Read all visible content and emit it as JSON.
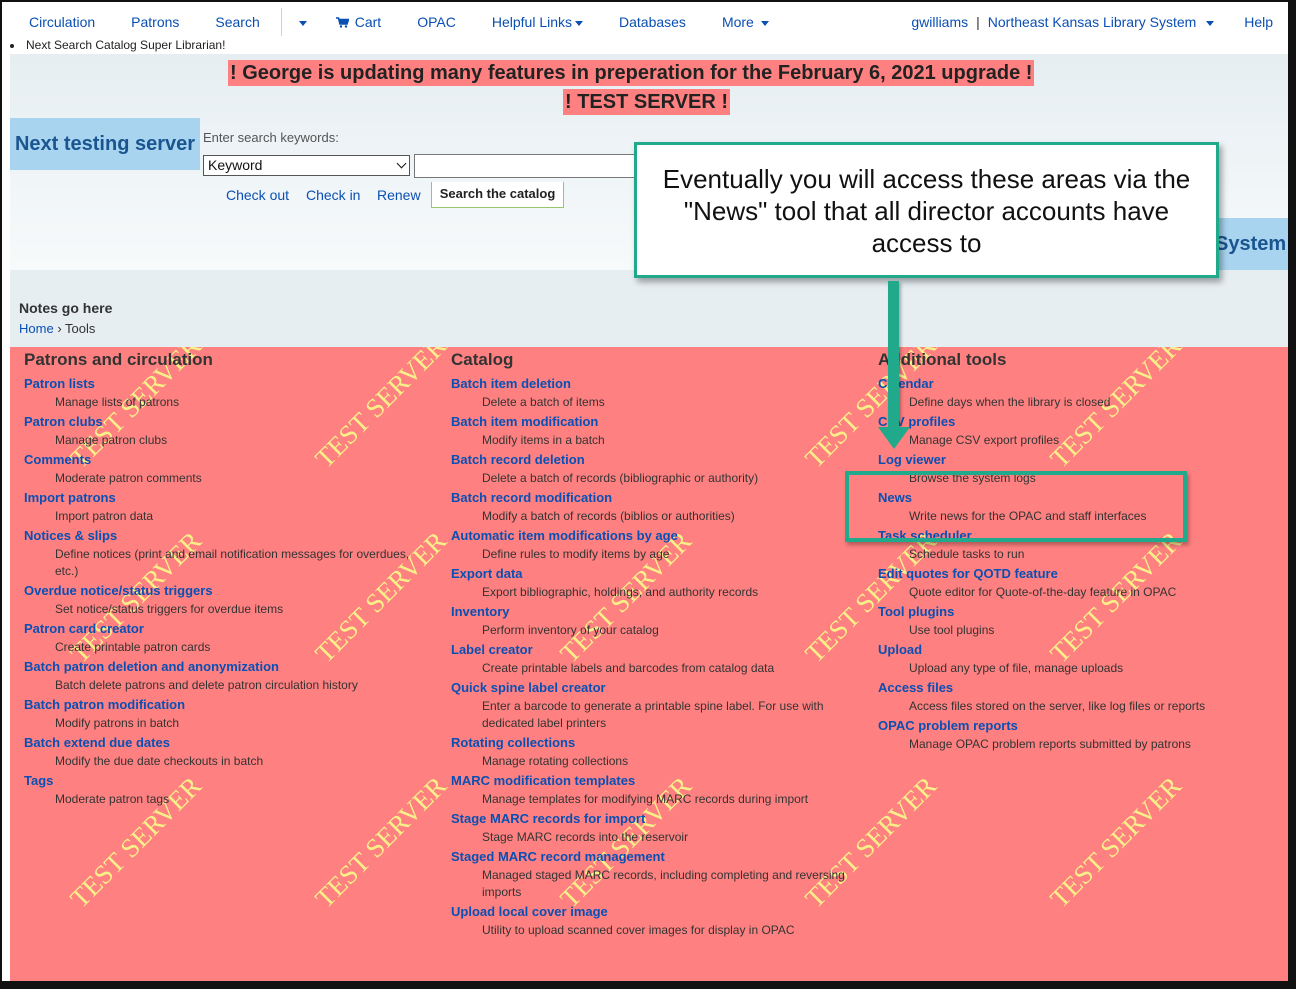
{
  "nav": {
    "items": [
      "Circulation",
      "Patrons",
      "Search"
    ],
    "cart": "Cart",
    "opac": "OPAC",
    "helpful_links": "Helpful Links",
    "databases": "Databases",
    "more": "More",
    "user": "gwilliams",
    "library": "Northeast Kansas Library System",
    "help": "Help"
  },
  "subline": "Next Search Catalog Super Librarian!",
  "alerts": {
    "line1": "! George is updating many features in preperation for the February 6, 2021 upgrade !",
    "line2": "! TEST SERVER !"
  },
  "header": {
    "server_label": "Next testing server",
    "server_label_right": "System"
  },
  "search": {
    "label": "Enter search keywords:",
    "select_value": "Keyword",
    "links": [
      "Check out",
      "Check in",
      "Renew"
    ],
    "tab": "Search the catalog"
  },
  "callout": "Eventually you will access these areas via the \"News\" tool that all director accounts have access to",
  "notes": "Notes go here",
  "breadcrumb": {
    "home": "Home",
    "sep": "›",
    "current": "Tools"
  },
  "columns": [
    {
      "heading": "Patrons and circulation",
      "tools": [
        {
          "title": "Patron lists",
          "desc": "Manage lists of patrons"
        },
        {
          "title": "Patron clubs",
          "desc": "Manage patron clubs"
        },
        {
          "title": "Comments",
          "desc": "Moderate patron comments"
        },
        {
          "title": "Import patrons",
          "desc": "Import patron data"
        },
        {
          "title": "Notices & slips",
          "desc": "Define notices (print and email notification messages for overdues, etc.)"
        },
        {
          "title": "Overdue notice/status triggers",
          "desc": "Set notice/status triggers for overdue items"
        },
        {
          "title": "Patron card creator",
          "desc": "Create printable patron cards"
        },
        {
          "title": "Batch patron deletion and anonymization",
          "desc": "Batch delete patrons and delete patron circulation history"
        },
        {
          "title": "Batch patron modification",
          "desc": "Modify patrons in batch"
        },
        {
          "title": "Batch extend due dates",
          "desc": "Modify the due date checkouts in batch"
        },
        {
          "title": "Tags",
          "desc": "Moderate patron tags"
        }
      ]
    },
    {
      "heading": "Catalog",
      "tools": [
        {
          "title": "Batch item deletion",
          "desc": "Delete a batch of items"
        },
        {
          "title": "Batch item modification",
          "desc": "Modify items in a batch"
        },
        {
          "title": "Batch record deletion",
          "desc": "Delete a batch of records (bibliographic or authority)"
        },
        {
          "title": "Batch record modification",
          "desc": "Modify a batch of records (biblios or authorities)"
        },
        {
          "title": "Automatic item modifications by age",
          "desc": "Define rules to modify items by age"
        },
        {
          "title": "Export data",
          "desc": "Export bibliographic, holdings, and authority records"
        },
        {
          "title": "Inventory",
          "desc": "Perform inventory of your catalog"
        },
        {
          "title": "Label creator",
          "desc": "Create printable labels and barcodes from catalog data"
        },
        {
          "title": "Quick spine label creator",
          "desc": "Enter a barcode to generate a printable spine label. For use with dedicated label printers"
        },
        {
          "title": "Rotating collections",
          "desc": "Manage rotating collections"
        },
        {
          "title": "MARC modification templates",
          "desc": "Manage templates for modifying MARC records during import"
        },
        {
          "title": "Stage MARC records for import",
          "desc": "Stage MARC records into the reservoir"
        },
        {
          "title": "Staged MARC record management",
          "desc": "Managed staged MARC records, including completing and reversing imports"
        },
        {
          "title": "Upload local cover image",
          "desc": "Utility to upload scanned cover images for display in OPAC"
        }
      ]
    },
    {
      "heading": "Additional tools",
      "tools": [
        {
          "title": "Calendar",
          "desc": "Define days when the library is closed"
        },
        {
          "title": "CSV profiles",
          "desc": "Manage CSV export profiles"
        },
        {
          "title": "Log viewer",
          "desc": "Browse the system logs"
        },
        {
          "title": "News",
          "desc": "Write news for the OPAC and staff interfaces"
        },
        {
          "title": "Task scheduler",
          "desc": "Schedule tasks to run"
        },
        {
          "title": "Edit quotes for QOTD feature",
          "desc": "Quote editor for Quote-of-the-day feature in OPAC"
        },
        {
          "title": "Tool plugins",
          "desc": "Use tool plugins"
        },
        {
          "title": "Upload",
          "desc": "Upload any type of file, manage uploads"
        },
        {
          "title": "Access files",
          "desc": "Access files stored on the server, like log files or reports"
        },
        {
          "title": "OPAC problem reports",
          "desc": "Manage OPAC problem reports submitted by patrons"
        }
      ]
    }
  ],
  "watermark": "TEST SERVER",
  "colors": {
    "link": "#0a4fb3",
    "alert_bg": "#ff8080",
    "callout_border": "#21a98c",
    "server_label_bg": "#a8d4f0",
    "watermark": "#f7f78a"
  }
}
